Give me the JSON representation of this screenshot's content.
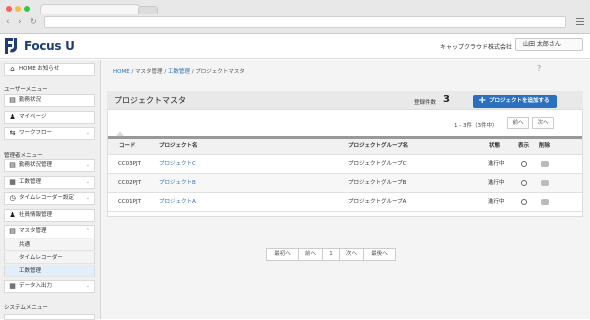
{
  "browser": {
    "address": ""
  },
  "app": {
    "brand": "Focus U",
    "company": "キャップクラウド株式会社",
    "user": "山田 太郎さん"
  },
  "sidebar": {
    "home": "HOME お知らせ",
    "user_menu_title": "ユーザーメニュー",
    "user_items": [
      "勤務状況",
      "マイページ",
      "ワークフロー"
    ],
    "admin_menu_title": "管理者メニュー",
    "admin_items": [
      "勤務状況管理",
      "工数管理",
      "タイムレコーダー設定",
      "社員情報管理",
      "マスタ管理"
    ],
    "master_sub": [
      "共通",
      "タイムレコーダー",
      "工数管理"
    ],
    "data_io": "データ入出力",
    "system_menu_title": "システムメニュー"
  },
  "breadcrumb": {
    "home": "HOME",
    "sep": "/",
    "master": "マスタ管理",
    "kousu": "工数管理",
    "current": "プロジェクトマスタ"
  },
  "help": "?",
  "panel": {
    "title": "プロジェクトマスタ",
    "reg_label": "登録件数",
    "reg_count": "3",
    "add_button": "プロジェクトを追加する",
    "add_icon": "+",
    "page_info": "1 - 3件（3件中）",
    "prev": "前へ",
    "next": "次へ"
  },
  "table": {
    "headers": {
      "code": "コード",
      "name": "プロジェクト名",
      "group": "プロジェクトグループ名",
      "status": "状態",
      "show": "表示",
      "delete": "削除"
    },
    "rows": [
      {
        "code": "CC03PJT",
        "name": "プロジェクトC",
        "group": "プロジェクトグループC",
        "status": "進行中"
      },
      {
        "code": "CC02PJT",
        "name": "プロジェクトB",
        "group": "プロジェクトグループB",
        "status": "進行中"
      },
      {
        "code": "CC01PJT",
        "name": "プロジェクトA",
        "group": "プロジェクトグループA",
        "status": "進行中"
      }
    ]
  },
  "pager": {
    "first": "最初へ",
    "prev": "前へ",
    "page": "1",
    "next": "次へ",
    "last": "最後へ"
  },
  "colors": {
    "accent": "#2b6fc1",
    "link": "#2d6db5",
    "brand": "#1d3c78"
  }
}
